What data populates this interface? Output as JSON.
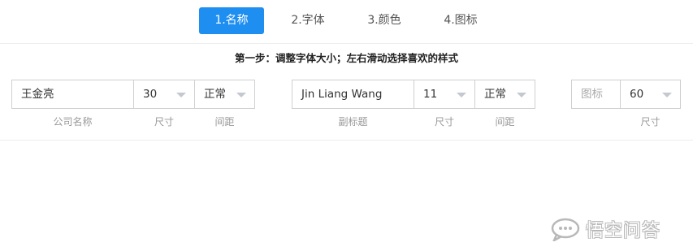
{
  "tabs": [
    {
      "label": "1.名称",
      "active": true
    },
    {
      "label": "2.字体",
      "active": false
    },
    {
      "label": "3.颜色",
      "active": false
    },
    {
      "label": "4.图标",
      "active": false
    }
  ],
  "step_text": "第一步：调整字体大小；左右滑动选择喜欢的样式",
  "company": {
    "name_value": "王金亮",
    "size_value": "30",
    "spacing_value": "正常",
    "name_caption": "公司名称",
    "size_caption": "尺寸",
    "spacing_caption": "间距"
  },
  "subtitle": {
    "name_value": "Jin Liang Wang",
    "size_value": "11",
    "spacing_value": "正常",
    "name_caption": "副标题",
    "size_caption": "尺寸",
    "spacing_caption": "间距"
  },
  "icon": {
    "placeholder": "图标",
    "size_value": "60",
    "size_caption": "尺寸"
  },
  "watermark": {
    "text": "悟空问答"
  },
  "colors": {
    "accent": "#1e8ef0",
    "border": "#cfcfcf",
    "caption": "#999999",
    "caret": "#c4c8d0"
  }
}
